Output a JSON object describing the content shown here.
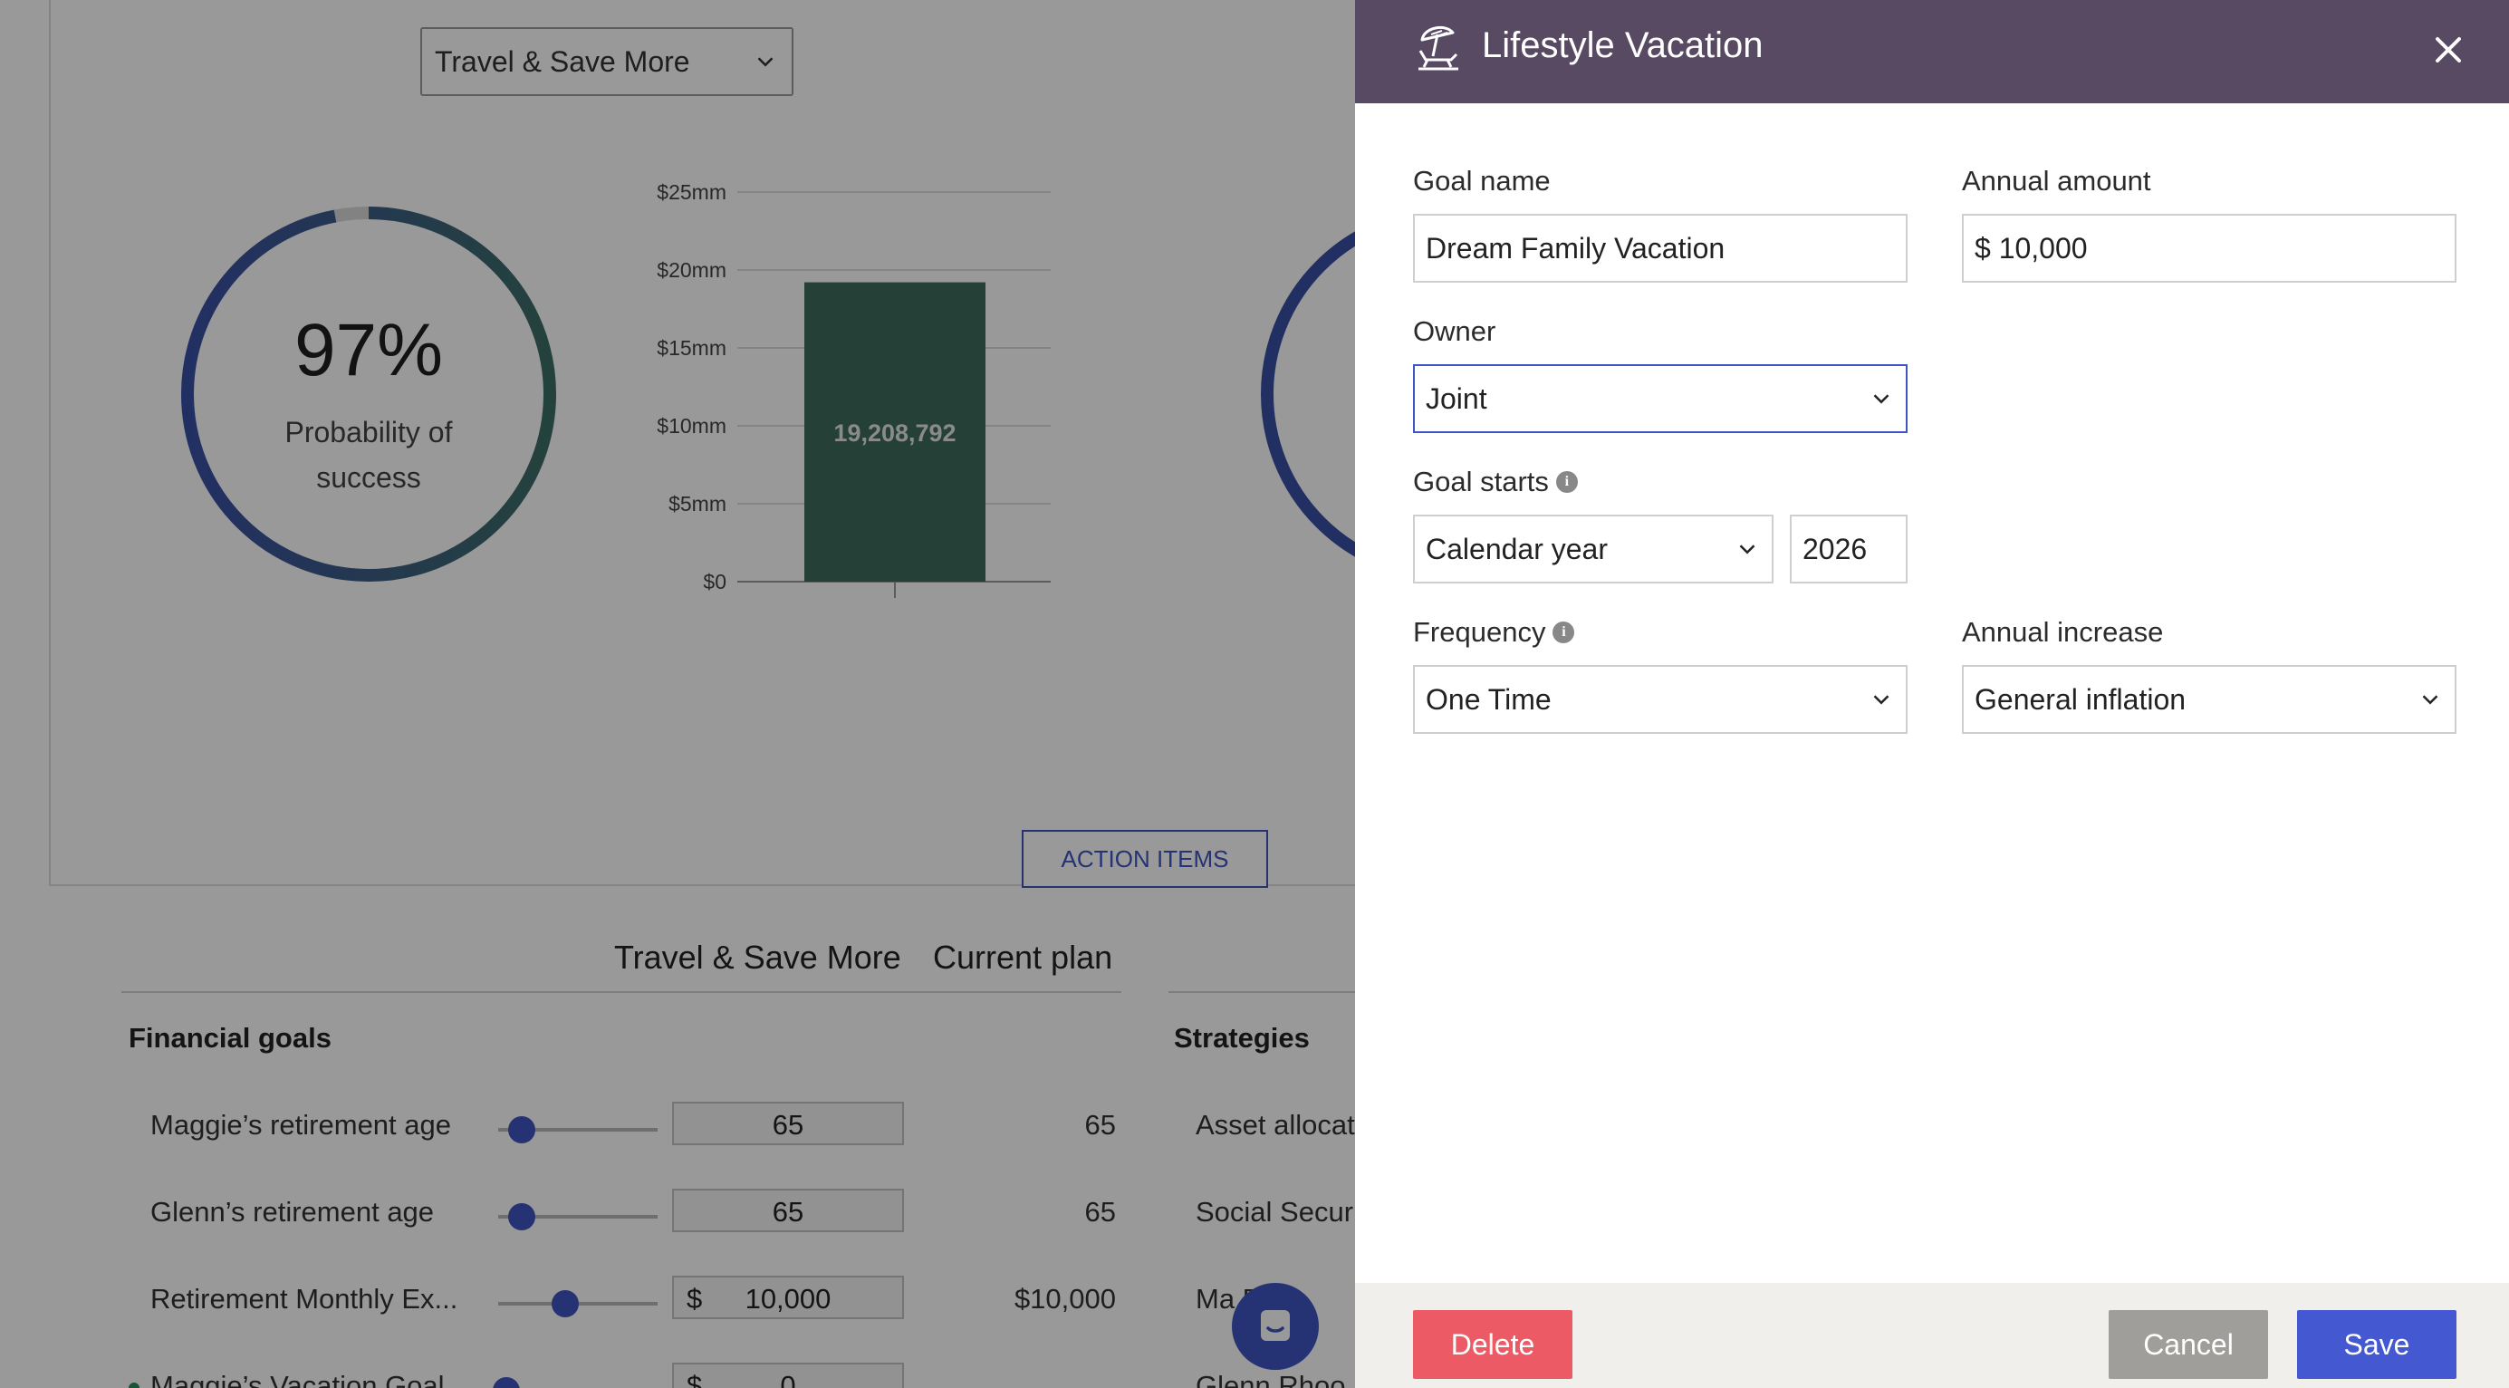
{
  "background": {
    "scenario_select": "Travel & Save More",
    "probability": {
      "value": "97%",
      "label": "Probability of success",
      "fraction": 0.97
    },
    "chart_data": {
      "type": "bar",
      "categories": [
        ""
      ],
      "values": [
        19208792
      ],
      "value_label": "19,208,792",
      "y_ticks": [
        "$0",
        "$5mm",
        "$10mm",
        "$15mm",
        "$20mm",
        "$25mm"
      ],
      "ylim": [
        0,
        25000000
      ],
      "bar_color": "#3e6b5a",
      "grid": true
    },
    "action_items": "ACTION ITEMS",
    "compare_headers": [
      "Travel & Save More",
      "Current plan"
    ],
    "financial_goals_title": "Financial goals",
    "strategies_title": "Strategies",
    "goals": [
      {
        "label": "Maggie’s retirement age",
        "value": "65",
        "current": "65",
        "currency": "",
        "slider": 0.15,
        "strategy": "Asset allocat"
      },
      {
        "label": "Glenn’s retirement age",
        "value": "65",
        "current": "65",
        "currency": "",
        "slider": 0.15,
        "strategy": "Social Secur"
      },
      {
        "label": "Retirement Monthly Ex...",
        "value": "10,000",
        "current": "$10,000",
        "currency": "$",
        "slider": 0.42,
        "strategy": "Ma      Rhe"
      },
      {
        "label": "Maggie’s Vacation Goal",
        "value": "0",
        "current": "",
        "currency": "$",
        "slider": 0.05,
        "strategy": "Glenn Rhoo",
        "dot": true
      }
    ]
  },
  "drawer": {
    "title": "Lifestyle Vacation",
    "icon": "beach-umbrella-icon",
    "fields": {
      "goal_name": {
        "label": "Goal name",
        "value": "Dream Family Vacation"
      },
      "annual_amount": {
        "label": "Annual amount",
        "value": "$ 10,000"
      },
      "owner": {
        "label": "Owner",
        "value": "Joint"
      },
      "goal_starts": {
        "label": "Goal starts",
        "type": "Calendar year",
        "year": "2026"
      },
      "frequency": {
        "label": "Frequency",
        "value": "One Time"
      },
      "annual_increase": {
        "label": "Annual increase",
        "value": "General inflation"
      }
    },
    "buttons": {
      "delete": "Delete",
      "cancel": "Cancel",
      "save": "Save"
    }
  },
  "colors": {
    "header": "#574a62",
    "accent": "#4358d1",
    "danger": "#ec5b65",
    "bar": "#3e6b5a"
  }
}
